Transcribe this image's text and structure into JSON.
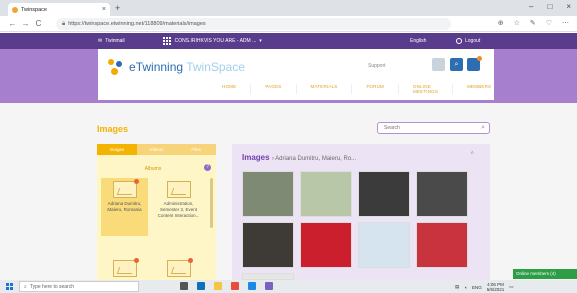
{
  "browser": {
    "tab_title": "Twinspace",
    "tab_close": "×",
    "new_tab": "+",
    "window_controls": [
      "–",
      "□",
      "×"
    ],
    "url": "https://twinspace.etwinning.net/118809/materials/images",
    "nav": [
      "←",
      "→",
      "C"
    ],
    "right_icons": [
      "⊕",
      "☆",
      "✎",
      "♡",
      "⋯"
    ]
  },
  "sitebar": {
    "brand": "Twinmail",
    "context": "CONS.IRIHKVIS YOU ARE - ADM ...",
    "language": "English",
    "logout": "Logout"
  },
  "header": {
    "logo_e": "e",
    "logo_twinning": "Twinning",
    "logo_twinspace": "TwinSpace",
    "support": "Support",
    "nav": [
      "HOME",
      "PAGES",
      "MATERIALS",
      "FORUM",
      "ONLINE MEETINGS",
      "MEMBERS"
    ]
  },
  "content": {
    "title": "Images",
    "search_placeholder": "Search",
    "left_tabs": [
      "Images",
      "Videos",
      "Files"
    ],
    "albums_heading": "Albums",
    "albums": [
      {
        "label": "Adriana Dumitru, Maieru, Romania",
        "selected": true
      },
      {
        "label": "Administration, Semester 2, Event Content Interaction..."
      },
      {
        "label": ""
      },
      {
        "label": ""
      }
    ],
    "right_title": "Images",
    "right_subtitle": "› Adriana Dumitru, Maieru, Ro...",
    "photos": [
      {
        "name": "classroom-photo",
        "color": "#7f8a74"
      },
      {
        "name": "tree-poster-photo",
        "color": "#b8c7a8"
      },
      {
        "name": "slides-grid-photo",
        "color": "#3b3b3b"
      },
      {
        "name": "video-call-photo",
        "color": "#4a4a4a"
      },
      {
        "name": "girl-portrait-photo",
        "color": "#3e3a36"
      },
      {
        "name": "romanian-flag-photo",
        "color": "#cc1f2d"
      },
      {
        "name": "friendship-circle-photo",
        "color": "#d6e4f0"
      },
      {
        "name": "heart-drawing-photo",
        "color": "#c9333d"
      },
      {
        "name": "friendship-letters-photo",
        "color": "#e6e6e6"
      }
    ]
  },
  "online_badge": "Online members (4)",
  "taskbar": {
    "search_placeholder": "Type here to search",
    "time": "4:06 PM",
    "date": "5/6/2021",
    "lang": "ENG"
  }
}
